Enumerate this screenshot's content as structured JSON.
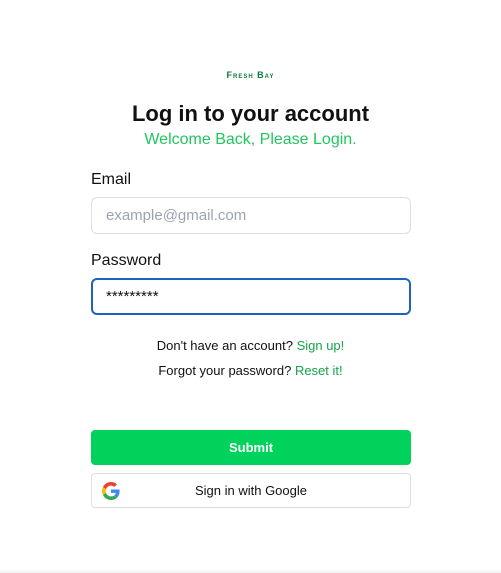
{
  "brand": {
    "logo_text": "Fresh Bay",
    "color": "#0b7a3b"
  },
  "header": {
    "title": "Log in to your account",
    "subtitle": "Welcome Back, Please Login.",
    "subtitle_color": "#22c55e"
  },
  "form": {
    "email": {
      "label": "Email",
      "value": "",
      "placeholder": "example@gmail.com"
    },
    "password": {
      "label": "Password",
      "value": "*********",
      "placeholder": "",
      "focused": true
    }
  },
  "links": {
    "signup_prompt": "Don't have an account?",
    "signup_link": "Sign up!",
    "forgot_prompt": "Forgot your password?",
    "forgot_link": "Reset it!"
  },
  "actions": {
    "submit_label": "Submit",
    "submit_color": "#00d25b",
    "google_label": "Sign in with Google",
    "google_icon": "google-g-icon"
  }
}
